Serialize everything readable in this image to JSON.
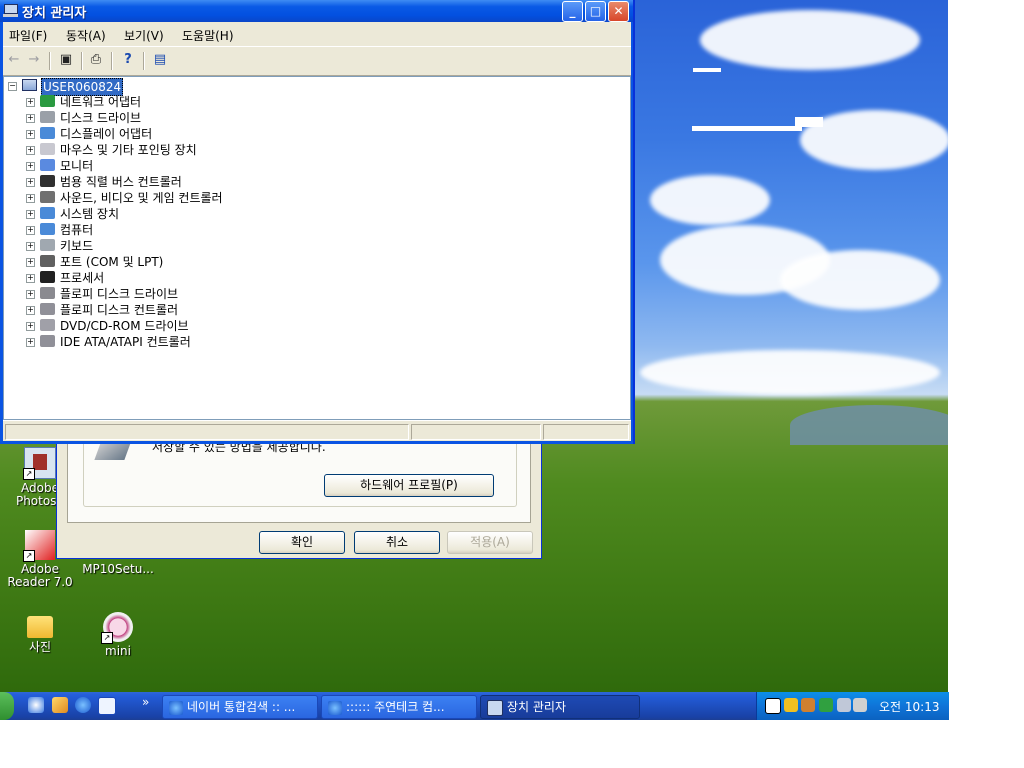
{
  "window": {
    "title": "장치 관리자",
    "controls": {
      "minimize": "_",
      "maximize": "□",
      "close": "✕"
    }
  },
  "menubar": [
    {
      "label": "파일(F)"
    },
    {
      "label": "동작(A)"
    },
    {
      "label": "보기(V)"
    },
    {
      "label": "도움말(H)"
    }
  ],
  "toolbar": {
    "back": "←",
    "forward": "→",
    "console": "▣",
    "print": "⎙",
    "help": "?",
    "scan": "▤"
  },
  "tree": {
    "root": "USER060824",
    "items": [
      {
        "label": "네트워크 어댑터",
        "icon": "network-adapter-icon"
      },
      {
        "label": "디스크 드라이브",
        "icon": "disk-drive-icon"
      },
      {
        "label": "디스플레이 어댑터",
        "icon": "display-adapter-icon"
      },
      {
        "label": "마우스 및 기타 포인팅 장치",
        "icon": "mouse-icon"
      },
      {
        "label": "모니터",
        "icon": "monitor-icon"
      },
      {
        "label": "범용 직렬 버스 컨트롤러",
        "icon": "usb-icon"
      },
      {
        "label": "사운드, 비디오 및 게임 컨트롤러",
        "icon": "sound-icon"
      },
      {
        "label": "시스템 장치",
        "icon": "system-device-icon"
      },
      {
        "label": "컴퓨터",
        "icon": "computer-icon"
      },
      {
        "label": "키보드",
        "icon": "keyboard-icon"
      },
      {
        "label": "포트 (COM 및 LPT)",
        "icon": "port-icon"
      },
      {
        "label": "프로세서",
        "icon": "processor-icon"
      },
      {
        "label": "플로피 디스크 드라이브",
        "icon": "floppy-drive-icon"
      },
      {
        "label": "플로피 디스크 컨트롤러",
        "icon": "floppy-controller-icon"
      },
      {
        "label": "DVD/CD-ROM 드라이브",
        "icon": "dvd-drive-icon"
      },
      {
        "label": "IDE ATA/ATAPI 컨트롤러",
        "icon": "ide-controller-icon"
      }
    ]
  },
  "background_dialog": {
    "text": "저장할 수 있는 방법을 제공합니다.",
    "hardware_profile_button": "하드웨어 프로필(P)",
    "ok_button": "확인",
    "cancel_button": "취소",
    "apply_button": "적용(A)"
  },
  "desktop_icons": [
    {
      "label": "Adobe Photosh"
    },
    {
      "label": "Adobe Reader 7.0"
    },
    {
      "label": "MP10Setu..."
    },
    {
      "label": "사진"
    },
    {
      "label": "mini"
    }
  ],
  "taskbar": {
    "quick_launch_more": "»",
    "tasks": [
      {
        "label": "네이버 통합검색 :: ...",
        "active": false
      },
      {
        "label": ":::::: 주연테크 컴...",
        "active": false
      },
      {
        "label": "장치 관리자",
        "active": true
      }
    ],
    "clock": "오전 10:13"
  },
  "colors": {
    "titlebar": "#0a5ae6",
    "selection": "#316ac5",
    "taskbar": "#245edb",
    "tray": "#0f74d8"
  }
}
